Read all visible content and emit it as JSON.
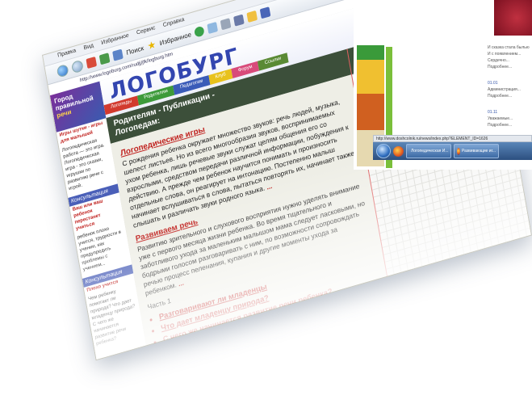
{
  "browser": {
    "menu": [
      "Правка",
      "Вид",
      "Избранное",
      "Сервис",
      "Справка"
    ],
    "toolbar": {
      "search_label": "Поиск",
      "favorites_label": "Избранное"
    },
    "address": "http://www.logoburg.com/rudjj/jfk/logburg.htm"
  },
  "site": {
    "logo": "ЛОГОБУРГ",
    "side_logo": [
      "Город",
      "правильной",
      "речи"
    ],
    "nav": [
      "Логопеды",
      "Родителям",
      "Педагогам",
      "Клуб",
      "Форум",
      "Ссылки"
    ],
    "nav_colors": [
      "#d23a2e",
      "#3d9a3a",
      "#3a5bb8",
      "#e8c21c",
      "#d84a7a",
      "#5a8a34"
    ],
    "page_title_line1": "Родителям - Публикации -",
    "page_title_line2": "Логопедам:",
    "sections": [
      {
        "heading": "Логопедические игры",
        "text": "С рождения ребенка окружает множество звуков: речь людей, музыка, шелест листьев. Но из всего многообразия звуков, воспринимаемых ухом ребенка, лишь речевые звуки служат целям общения его со взрослыми, средством передачи различной информации, побуждения к действию. А прежде чем ребенок научится понимать и произносить отдельные слова, он реагирует на интонацию. Постепенно малыш начинает вслушиваться в слова, пытаться повторять их, начинает также слышать и различать звуки родного языка.",
        "more": "..."
      },
      {
        "heading": "Развиваем речь",
        "text": "Развитию зрительного и слухового восприятия нужно уделять внимание уже с первого месяца жизни ребенка. Во время тщательного и заботливого ухода за маленьким малышом мама следует ласковыми, но бодрыми голосом разговаривать с ним, по возможности сопровождать речью процесс пеленания, купания и другие моменты ухода за ребенком.",
        "more": "..."
      }
    ],
    "part_label": "Часть 1",
    "links": [
      "Разговаривают ли младенцы",
      "Что дает младенцу природа?",
      "С чего же начинается развитие речи ребенка?"
    ],
    "sidebar": {
      "heading1": "Консультация",
      "text1": "Логопедическая работа — это игра. Логопедическая игра - это сказки, игрушки по развитию речи с игрой.",
      "link1": "Игры шутки - игры для малышей",
      "heading2": "Консультация",
      "link2": "Ваш или ваш ребенок перестанет учиться",
      "text2": "ребенок плохо учится, трудности в учении, как предупредить проблемы с учением...",
      "heading3": "Консультация",
      "link3": "Плохо учится",
      "text3": "Чем ребенку помогает ли природа? Что дает младенцу природа? С чего же начинается развитие речи ребенка?"
    }
  },
  "window2": {
    "news": [
      {
        "line1": "И сказка стала былью",
        "line2": "И с появлением...",
        "line3": "Сердечно...",
        "line4": "Подробнее..."
      },
      {
        "date": "01.01",
        "line1": "Администрация...",
        "line2": "Подробнее..."
      },
      {
        "date": "01.11",
        "line1": "Уважаемые...",
        "line2": "Подробнее..."
      }
    ],
    "status_url": "http://www.doshcolnik.ru/news/index.php?ELEMENT_ID=1626",
    "taskbar_items": [
      "Логопедическая И...",
      "Развивающие иг..."
    ]
  }
}
